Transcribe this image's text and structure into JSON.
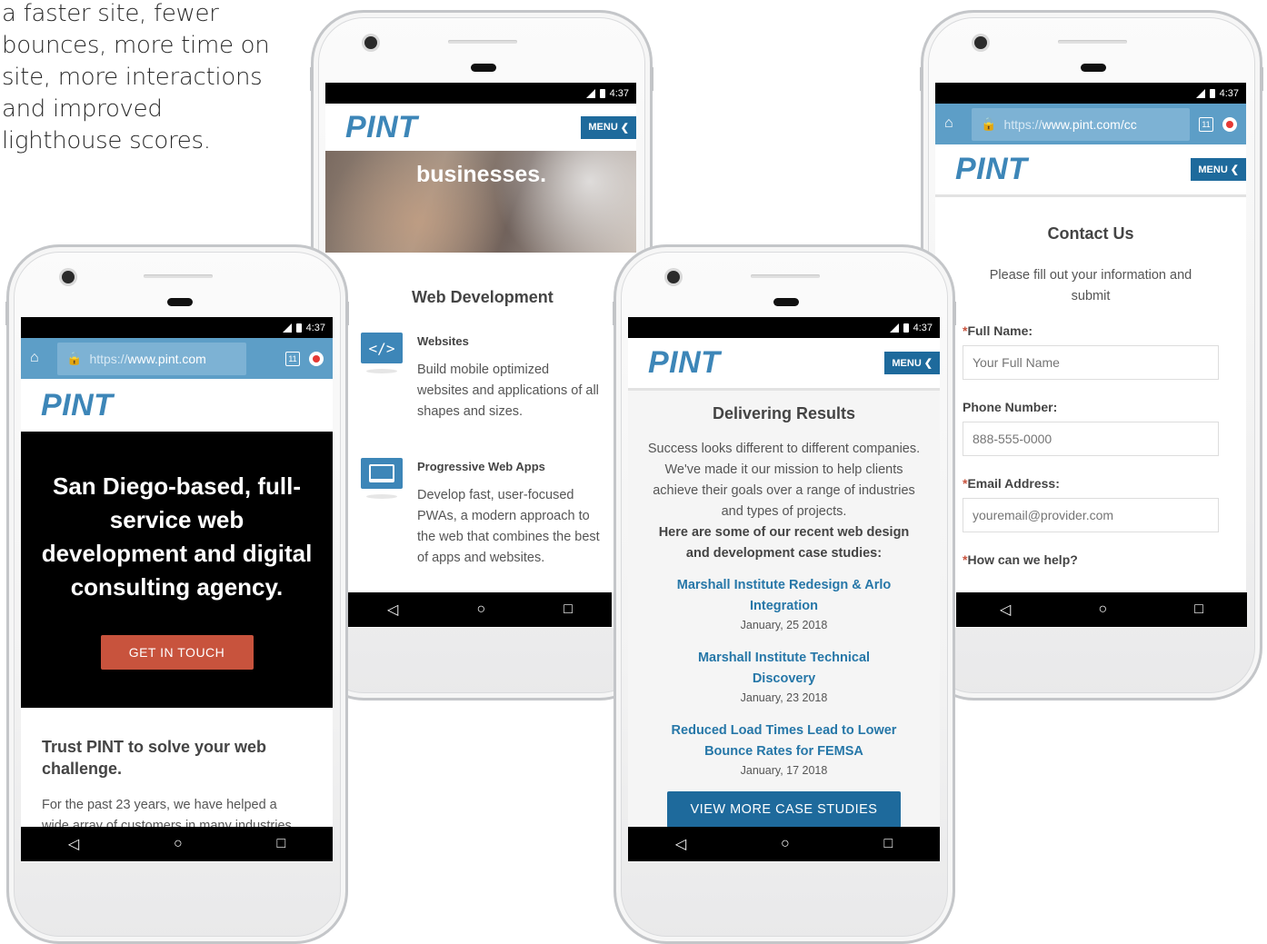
{
  "intro_text": "a faster site, fewer bounces, more time on site, more interactions and improved lighthouse scores.",
  "status": {
    "time": "4:37"
  },
  "browser": {
    "url_prefix": "https://",
    "url_home": "www.pint.com",
    "url_contact": "www.pint.com/cc",
    "tab_count": "11"
  },
  "brand": {
    "logo": "PINT",
    "menu_label": "MENU"
  },
  "colors": {
    "brand_blue": "#3d86b8",
    "menu_blue": "#1e6a9c",
    "chrome_blue": "#5d9ec7",
    "cta_red": "#c8533d",
    "link_blue": "#2677a8"
  },
  "phone_home": {
    "hero_text": "San Diego-based, full-service web development and digital consulting agency.",
    "cta_label": "GET IN TOUCH",
    "section_title": "Trust PINT to solve your web challenge.",
    "section_body": "For the past 23 years, we have helped a wide array of customers in many industries"
  },
  "phone_services": {
    "banner_text": "businesses.",
    "section_title": "Web Development",
    "services": [
      {
        "icon": "code-icon",
        "title": "Websites",
        "desc": "Build mobile optimized websites and applications of all shapes and sizes."
      },
      {
        "icon": "laptop-icon",
        "title": "Progressive Web Apps",
        "desc": "Develop fast, user-focused PWAs, a modern approach to the web that combines the best of apps and websites."
      }
    ]
  },
  "phone_results": {
    "title": "Delivering Results",
    "intro": "Success looks different to different companies. We've made it our mission to help clients achieve their goals over a range of industries and types of projects.",
    "intro_bold": "Here are some of our recent web design and development case studies:",
    "case_studies": [
      {
        "title": "Marshall Institute Redesign & Arlo Integration",
        "date": "January, 25 2018"
      },
      {
        "title": "Marshall Institute Technical Discovery",
        "date": "January, 23 2018"
      },
      {
        "title": "Reduced Load Times Lead to Lower Bounce Rates for FEMSA",
        "date": "January, 17 2018"
      }
    ],
    "cta_label": "VIEW MORE CASE STUDIES"
  },
  "phone_contact": {
    "title": "Contact Us",
    "subtitle": "Please fill out your information and submit",
    "fields": [
      {
        "label": "Full Name:",
        "required": "*",
        "placeholder": "Your Full Name"
      },
      {
        "label": "Phone Number:",
        "required": "",
        "placeholder": "888-555-0000"
      },
      {
        "label": "Email Address:",
        "required": "*",
        "placeholder": "youremail@provider.com"
      }
    ],
    "help_label": "How can we help?",
    "help_required": "*"
  }
}
